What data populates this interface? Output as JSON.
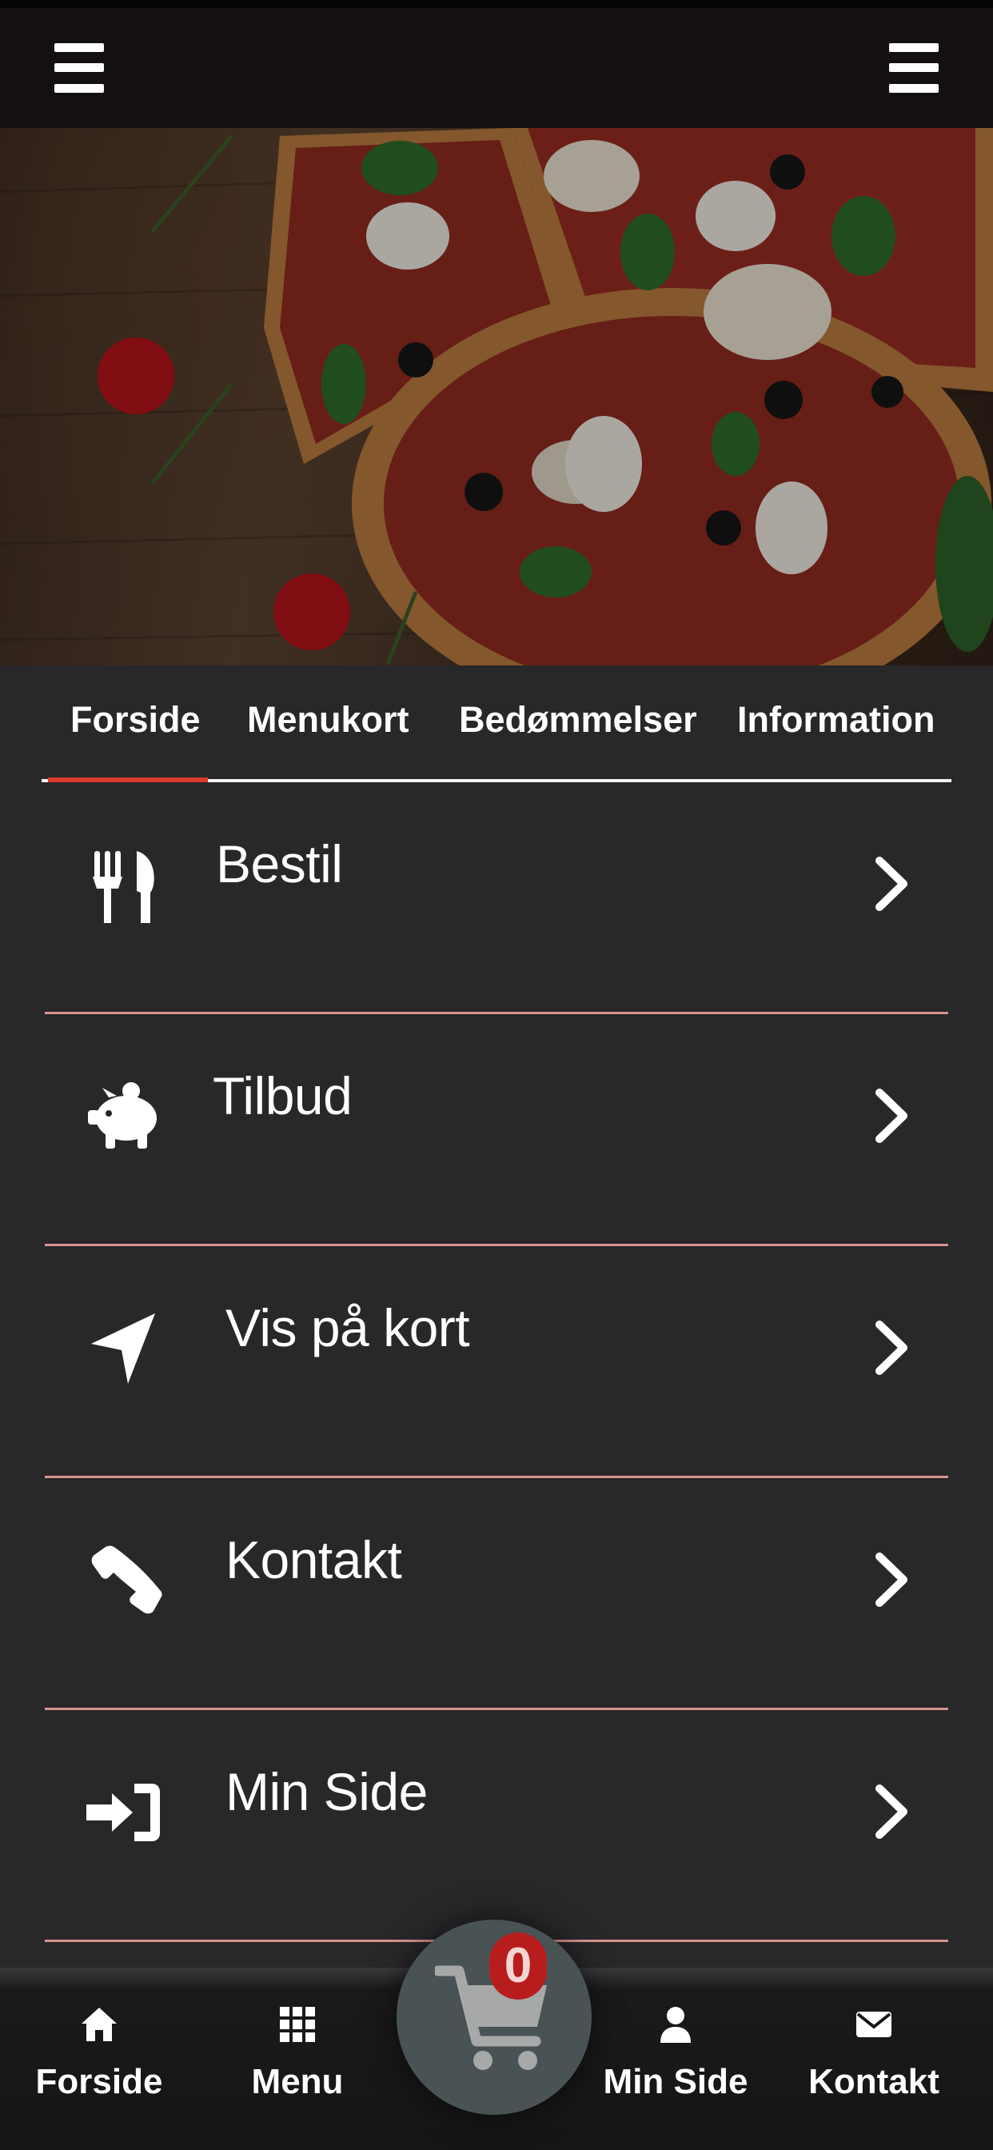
{
  "header": {
    "left_menu_icon": "hamburger-icon",
    "right_menu_icon": "hamburger-icon"
  },
  "hero": {
    "image": "pizza-photo"
  },
  "tabs": [
    {
      "label": "Forside",
      "active": true
    },
    {
      "label": "Menukort",
      "active": false
    },
    {
      "label": "Bedømmelser",
      "active": false
    },
    {
      "label": "Information",
      "active": false
    }
  ],
  "menu_items": [
    {
      "label": "Bestil",
      "icon": "utensils-icon"
    },
    {
      "label": "Tilbud",
      "icon": "piggy-bank-icon"
    },
    {
      "label": "Vis på kort",
      "icon": "location-arrow-icon"
    },
    {
      "label": "Kontakt",
      "icon": "phone-icon"
    },
    {
      "label": "Min Side",
      "icon": "sign-in-icon"
    }
  ],
  "bottom_nav": {
    "items": [
      {
        "label": "Forside",
        "icon": "home-icon"
      },
      {
        "label": "Menu",
        "icon": "grid-icon"
      },
      {
        "label": "Min Side",
        "icon": "user-icon"
      },
      {
        "label": "Kontakt",
        "icon": "envelope-icon"
      }
    ],
    "cart": {
      "count": "0",
      "icon": "shopping-cart-icon"
    }
  },
  "colors": {
    "background": "#28272a",
    "accent": "#d93a2c",
    "divider": "#d8938e",
    "badge": "#b81d1d"
  }
}
